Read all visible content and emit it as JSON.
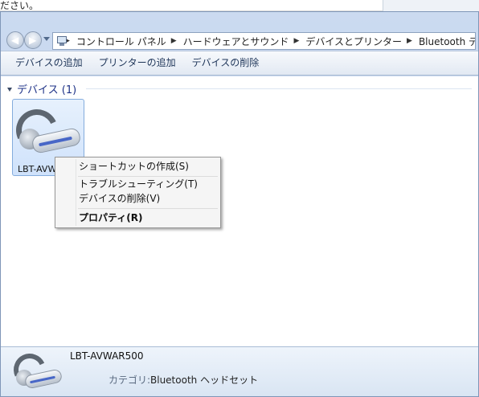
{
  "background_text": "ださい。",
  "address_bar": {
    "crumbs": [
      "コントロール パネル",
      "ハードウェアとサウンド",
      "デバイスとプリンター",
      "Bluetooth デバイス"
    ]
  },
  "toolbar": {
    "add_device": "デバイスの追加",
    "add_printer": "プリンターの追加",
    "remove_device": "デバイスの削除"
  },
  "group": {
    "header": "デバイス (1)"
  },
  "device": {
    "name_truncated": "LBT-AVW"
  },
  "context_menu": {
    "items": [
      "ショートカットの作成(S)",
      "トラブルシューティング(T)",
      "デバイスの削除(V)",
      "プロパティ(R)"
    ]
  },
  "details": {
    "name": "LBT-AVWAR500",
    "category_label": "カテゴリ:",
    "category_value": "Bluetooth ヘッドセット"
  },
  "colors": {
    "accent": "#4867c7",
    "header_text": "#1e3287"
  }
}
